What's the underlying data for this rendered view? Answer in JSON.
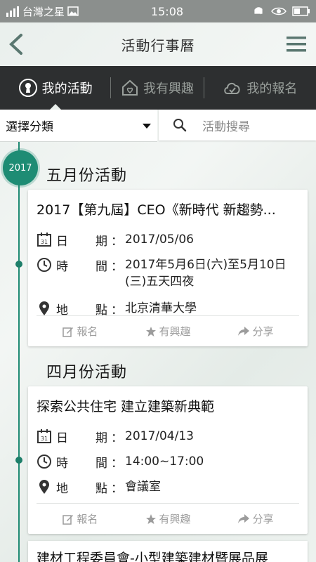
{
  "status_bar": {
    "carrier": "台灣之星",
    "time": "15:08"
  },
  "header": {
    "title": "活動行事曆"
  },
  "tabs": [
    {
      "label": "我的活動",
      "icon": "keyhole-icon",
      "active": true
    },
    {
      "label": "我有興趣",
      "icon": "heart-house-icon",
      "active": false
    },
    {
      "label": "我的報名",
      "icon": "cloud-check-icon",
      "active": false
    }
  ],
  "filter": {
    "category_label": "選擇分類",
    "search_placeholder": "活動搜尋"
  },
  "year": "2017",
  "sections": [
    {
      "title": "五月份活動",
      "card": {
        "title": "2017【第九屆】CEO《新時代 新趨勢...",
        "date_label": "期",
        "date_label_pre": "日",
        "date": "2017/05/06",
        "time_label_pre": "時",
        "time_label": "間",
        "time": "2017年5月6日(六)至5月10日(三)五天四夜",
        "place_label_pre": "地",
        "place_label": "點",
        "place": "北京清華大學",
        "actions": [
          "報名",
          "有興趣",
          "分享"
        ]
      }
    },
    {
      "title": "四月份活動",
      "card": {
        "title": "探索公共住宅 建立建築新典範",
        "date_label": "期",
        "date_label_pre": "日",
        "date": "2017/04/13",
        "time_label_pre": "時",
        "time_label": "間",
        "time": "14:00~17:00",
        "place_label_pre": "地",
        "place_label": "點",
        "place": "會議室",
        "actions": [
          "報名",
          "有興趣",
          "分享"
        ]
      }
    }
  ],
  "partial_card": {
    "title": "建材工程委員會-小型建築建材暨展品展"
  },
  "colors": {
    "accent": "#1e8c74",
    "tabbar": "#2d2f30"
  }
}
